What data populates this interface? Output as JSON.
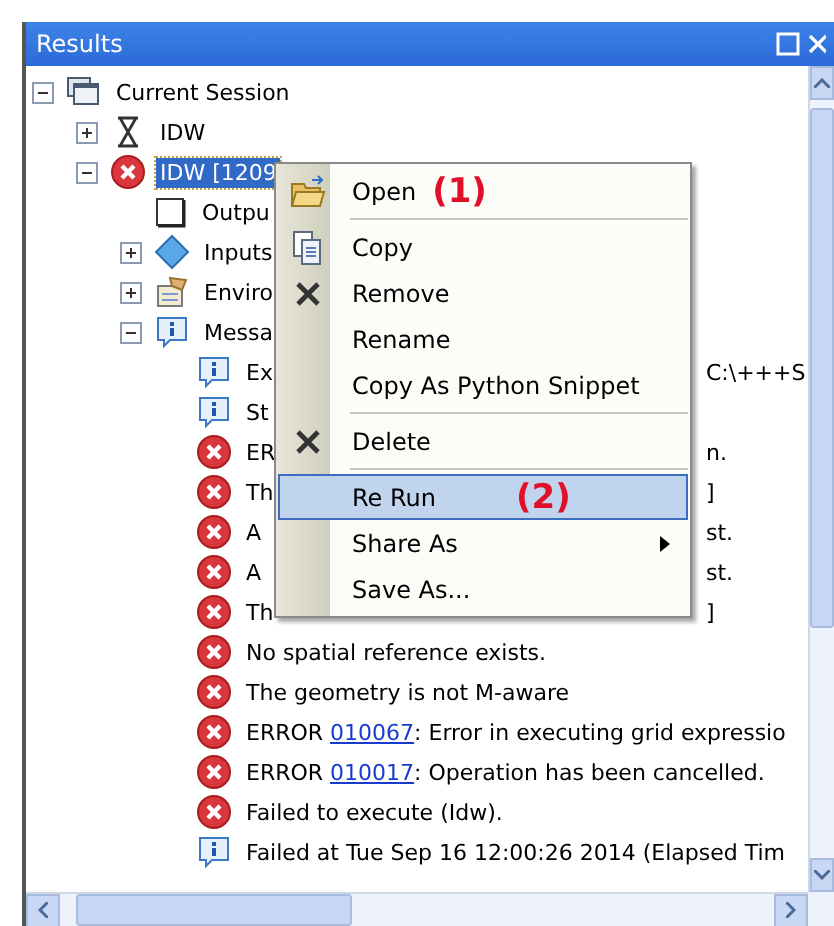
{
  "window": {
    "title": "Results"
  },
  "tree": [
    {
      "text": "Current Session",
      "kind": "session",
      "expanded": true,
      "selected": false,
      "children": [
        {
          "text": "IDW",
          "kind": "hourglass",
          "expanded": false,
          "selected": false
        },
        {
          "text": "IDW [1209",
          "kind": "error",
          "expanded": true,
          "selected": true,
          "children": [
            {
              "text": "Outpu",
              "kind": "output",
              "selected": false
            },
            {
              "text": "Inputs",
              "kind": "inputs",
              "expanded": false,
              "selected": false
            },
            {
              "text": "Enviro",
              "kind": "environments",
              "expanded": false,
              "selected": false
            },
            {
              "text": "Messa",
              "kind": "info",
              "expanded": true,
              "selected": false,
              "children": [
                {
                  "text": "Ex",
                  "kind": "info",
                  "right": "C:\\+++S",
                  "selected": false
                },
                {
                  "text": "St",
                  "kind": "info",
                  "selected": false
                },
                {
                  "text": "ER",
                  "kind": "error",
                  "right": "n.",
                  "selected": false
                },
                {
                  "text": "Th",
                  "kind": "error",
                  "right": "]",
                  "selected": false
                },
                {
                  "text": "A",
                  "kind": "error",
                  "right": "st.",
                  "selected": false
                },
                {
                  "text": "A",
                  "kind": "error",
                  "right": "st.",
                  "selected": false
                },
                {
                  "text": "Th",
                  "kind": "error",
                  "right": "]",
                  "selected": false
                },
                {
                  "text": "No spatial reference exists.",
                  "kind": "error",
                  "selected": false
                },
                {
                  "text": "The geometry is not M-aware",
                  "kind": "error",
                  "selected": false
                },
                {
                  "text": "ERROR ",
                  "link": "010067",
                  "after": ": Error in executing grid expressio",
                  "kind": "error",
                  "selected": false
                },
                {
                  "text": "ERROR ",
                  "link": "010017",
                  "after": ": Operation has been cancelled.",
                  "kind": "error",
                  "selected": false
                },
                {
                  "text": "Failed to execute (Idw).",
                  "kind": "error",
                  "selected": false
                },
                {
                  "text": "Failed at Tue Sep 16 12:00:26 2014 (Elapsed Tim",
                  "kind": "info",
                  "selected": false
                }
              ]
            }
          ]
        }
      ]
    }
  ],
  "context_menu": [
    {
      "kind": "folder",
      "label": "Open",
      "annotation": "(1)",
      "selected": false,
      "submenu": false
    },
    {
      "kind": "separator"
    },
    {
      "kind": "copy",
      "label": "Copy",
      "selected": false,
      "submenu": false
    },
    {
      "kind": "cross",
      "label": "Remove",
      "selected": false,
      "submenu": false
    },
    {
      "kind": "plain",
      "label": "Rename",
      "selected": false,
      "submenu": false
    },
    {
      "kind": "plain",
      "label": "Copy As Python Snippet",
      "selected": false,
      "submenu": false
    },
    {
      "kind": "separator"
    },
    {
      "kind": "cross",
      "label": "Delete",
      "selected": false,
      "submenu": false
    },
    {
      "kind": "separator"
    },
    {
      "kind": "plain",
      "label": "Re Run",
      "annotation": "(2)",
      "selected": true,
      "submenu": false
    },
    {
      "kind": "plain",
      "label": "Share As",
      "selected": false,
      "submenu": true
    },
    {
      "kind": "plain",
      "label": "Save As...",
      "selected": false,
      "submenu": false
    }
  ]
}
